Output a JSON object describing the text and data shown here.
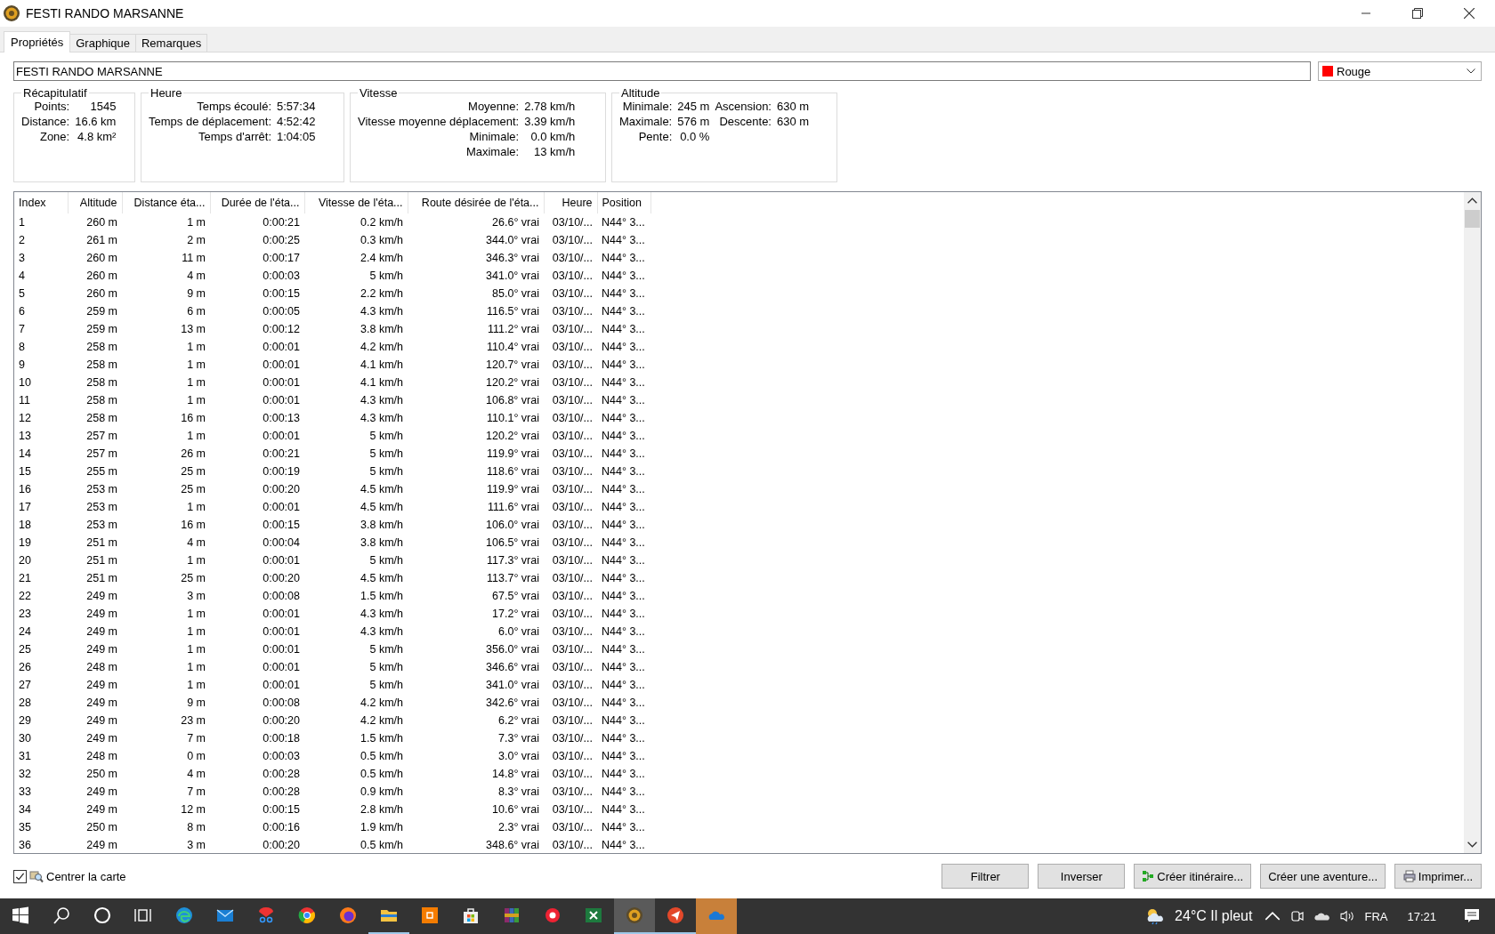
{
  "window": {
    "title": "FESTI RANDO MARSANNE"
  },
  "tabs": [
    {
      "label": "Propriétés",
      "selected": true
    },
    {
      "label": "Graphique",
      "selected": false
    },
    {
      "label": "Remarques",
      "selected": false
    }
  ],
  "name_field": {
    "value": "FESTI RANDO MARSANNE"
  },
  "color_select": {
    "value": "Rouge",
    "color": "#ff0000"
  },
  "groups": [
    {
      "title": "Récapitulatif",
      "rows": [
        [
          {
            "label": "Points:",
            "value": "1545"
          }
        ],
        [
          {
            "label": "Distance:",
            "value": "16.6 km"
          }
        ],
        [
          {
            "label": "Zone:",
            "value": "4.8 km²"
          }
        ]
      ]
    },
    {
      "title": "Heure",
      "rows": [
        [
          {
            "label": "Temps écoulé:",
            "value": "5:57:34"
          }
        ],
        [
          {
            "label": "Temps de déplacement:",
            "value": "4:52:42"
          }
        ],
        [
          {
            "label": "Temps d'arrêt:",
            "value": "1:04:05"
          }
        ]
      ]
    },
    {
      "title": "Vitesse",
      "rows": [
        [
          {
            "label": "Moyenne:",
            "value": "2.78 km/h"
          }
        ],
        [
          {
            "label": "Vitesse moyenne déplacement:",
            "value": "3.39 km/h"
          }
        ],
        [
          {
            "label": "Minimale:",
            "value": "0.0 km/h"
          }
        ],
        [
          {
            "label": "Maximale:",
            "value": "13 km/h"
          }
        ]
      ]
    },
    {
      "title": "Altitude",
      "rows": [
        [
          {
            "label": "Minimale:",
            "value": "245 m"
          },
          {
            "label": "Ascension:",
            "value": "630 m"
          }
        ],
        [
          {
            "label": "Maximale:",
            "value": "576 m"
          },
          {
            "label": "Descente:",
            "value": "630 m"
          }
        ],
        [
          {
            "label": "Pente:",
            "value": "0.0 %"
          }
        ]
      ]
    }
  ],
  "table": {
    "columns": [
      "Index",
      "Altitude",
      "Distance éta...",
      "Durée de l'éta...",
      "Vitesse de l'éta...",
      "Route désirée de l'éta...",
      "Heure",
      "Position"
    ],
    "rows": [
      [
        "1",
        "260 m",
        "1 m",
        "0:00:21",
        "0.2 km/h",
        "26.6° vrai",
        "03/10/...",
        "N44° 3..."
      ],
      [
        "2",
        "261 m",
        "2 m",
        "0:00:25",
        "0.3 km/h",
        "344.0° vrai",
        "03/10/...",
        "N44° 3..."
      ],
      [
        "3",
        "260 m",
        "11 m",
        "0:00:17",
        "2.4 km/h",
        "346.3° vrai",
        "03/10/...",
        "N44° 3..."
      ],
      [
        "4",
        "260 m",
        "4 m",
        "0:00:03",
        "5 km/h",
        "341.0° vrai",
        "03/10/...",
        "N44° 3..."
      ],
      [
        "5",
        "260 m",
        "9 m",
        "0:00:15",
        "2.2 km/h",
        "85.0° vrai",
        "03/10/...",
        "N44° 3..."
      ],
      [
        "6",
        "259 m",
        "6 m",
        "0:00:05",
        "4.3 km/h",
        "116.5° vrai",
        "03/10/...",
        "N44° 3..."
      ],
      [
        "7",
        "259 m",
        "13 m",
        "0:00:12",
        "3.8 km/h",
        "111.2° vrai",
        "03/10/...",
        "N44° 3..."
      ],
      [
        "8",
        "258 m",
        "1 m",
        "0:00:01",
        "4.2 km/h",
        "110.4° vrai",
        "03/10/...",
        "N44° 3..."
      ],
      [
        "9",
        "258 m",
        "1 m",
        "0:00:01",
        "4.1 km/h",
        "120.7° vrai",
        "03/10/...",
        "N44° 3..."
      ],
      [
        "10",
        "258 m",
        "1 m",
        "0:00:01",
        "4.1 km/h",
        "120.2° vrai",
        "03/10/...",
        "N44° 3..."
      ],
      [
        "11",
        "258 m",
        "1 m",
        "0:00:01",
        "4.3 km/h",
        "106.8° vrai",
        "03/10/...",
        "N44° 3..."
      ],
      [
        "12",
        "258 m",
        "16 m",
        "0:00:13",
        "4.3 km/h",
        "110.1° vrai",
        "03/10/...",
        "N44° 3..."
      ],
      [
        "13",
        "257 m",
        "1 m",
        "0:00:01",
        "5 km/h",
        "120.2° vrai",
        "03/10/...",
        "N44° 3..."
      ],
      [
        "14",
        "257 m",
        "26 m",
        "0:00:21",
        "5 km/h",
        "119.9° vrai",
        "03/10/...",
        "N44° 3..."
      ],
      [
        "15",
        "255 m",
        "25 m",
        "0:00:19",
        "5 km/h",
        "118.6° vrai",
        "03/10/...",
        "N44° 3..."
      ],
      [
        "16",
        "253 m",
        "25 m",
        "0:00:20",
        "4.5 km/h",
        "119.9° vrai",
        "03/10/...",
        "N44° 3..."
      ],
      [
        "17",
        "253 m",
        "1 m",
        "0:00:01",
        "4.5 km/h",
        "111.6° vrai",
        "03/10/...",
        "N44° 3..."
      ],
      [
        "18",
        "253 m",
        "16 m",
        "0:00:15",
        "3.8 km/h",
        "106.0° vrai",
        "03/10/...",
        "N44° 3..."
      ],
      [
        "19",
        "251 m",
        "4 m",
        "0:00:04",
        "3.8 km/h",
        "106.5° vrai",
        "03/10/...",
        "N44° 3..."
      ],
      [
        "20",
        "251 m",
        "1 m",
        "0:00:01",
        "5 km/h",
        "117.3° vrai",
        "03/10/...",
        "N44° 3..."
      ],
      [
        "21",
        "251 m",
        "25 m",
        "0:00:20",
        "4.5 km/h",
        "113.7° vrai",
        "03/10/...",
        "N44° 3..."
      ],
      [
        "22",
        "249 m",
        "3 m",
        "0:00:08",
        "1.5 km/h",
        "67.5° vrai",
        "03/10/...",
        "N44° 3..."
      ],
      [
        "23",
        "249 m",
        "1 m",
        "0:00:01",
        "4.3 km/h",
        "17.2° vrai",
        "03/10/...",
        "N44° 3..."
      ],
      [
        "24",
        "249 m",
        "1 m",
        "0:00:01",
        "4.3 km/h",
        "6.0° vrai",
        "03/10/...",
        "N44° 3..."
      ],
      [
        "25",
        "249 m",
        "1 m",
        "0:00:01",
        "5 km/h",
        "356.0° vrai",
        "03/10/...",
        "N44° 3..."
      ],
      [
        "26",
        "248 m",
        "1 m",
        "0:00:01",
        "5 km/h",
        "346.6° vrai",
        "03/10/...",
        "N44° 3..."
      ],
      [
        "27",
        "249 m",
        "1 m",
        "0:00:01",
        "5 km/h",
        "341.0° vrai",
        "03/10/...",
        "N44° 3..."
      ],
      [
        "28",
        "249 m",
        "9 m",
        "0:00:08",
        "4.2 km/h",
        "342.6° vrai",
        "03/10/...",
        "N44° 3..."
      ],
      [
        "29",
        "249 m",
        "23 m",
        "0:00:20",
        "4.2 km/h",
        "6.2° vrai",
        "03/10/...",
        "N44° 3..."
      ],
      [
        "30",
        "249 m",
        "7 m",
        "0:00:18",
        "1.5 km/h",
        "7.3° vrai",
        "03/10/...",
        "N44° 3..."
      ],
      [
        "31",
        "248 m",
        "0 m",
        "0:00:03",
        "0.5 km/h",
        "3.0° vrai",
        "03/10/...",
        "N44° 3..."
      ],
      [
        "32",
        "250 m",
        "4 m",
        "0:00:28",
        "0.5 km/h",
        "14.8° vrai",
        "03/10/...",
        "N44° 3..."
      ],
      [
        "33",
        "249 m",
        "7 m",
        "0:00:28",
        "0.9 km/h",
        "8.3° vrai",
        "03/10/...",
        "N44° 3..."
      ],
      [
        "34",
        "249 m",
        "12 m",
        "0:00:15",
        "2.8 km/h",
        "10.6° vrai",
        "03/10/...",
        "N44° 3..."
      ],
      [
        "35",
        "250 m",
        "8 m",
        "0:00:16",
        "1.9 km/h",
        "2.3° vrai",
        "03/10/...",
        "N44° 3..."
      ],
      [
        "36",
        "249 m",
        "3 m",
        "0:00:20",
        "0.5 km/h",
        "348.6° vrai",
        "03/10/...",
        "N44° 3..."
      ]
    ]
  },
  "center_map": {
    "label": "Centrer la carte",
    "checked": true
  },
  "buttons": [
    {
      "label": "Filtrer",
      "kind": "plain"
    },
    {
      "label": "Inverser",
      "kind": "plain"
    },
    {
      "label": "Créer itinéraire...",
      "kind": "route"
    },
    {
      "label": "Créer une aventure...",
      "kind": "plain"
    },
    {
      "label": "Imprimer...",
      "kind": "print"
    }
  ],
  "taskbar": {
    "apps": [
      {
        "running": false,
        "selected": false,
        "flashing": false
      },
      {
        "running": false,
        "selected": false,
        "flashing": false
      },
      {
        "running": false,
        "selected": false,
        "flashing": false
      },
      {
        "running": false,
        "selected": false,
        "flashing": false
      },
      {
        "running": false,
        "selected": false,
        "flashing": false
      },
      {
        "running": false,
        "selected": false,
        "flashing": false
      },
      {
        "running": false,
        "selected": false,
        "flashing": false
      },
      {
        "running": false,
        "selected": false,
        "flashing": false
      },
      {
        "running": false,
        "selected": false,
        "flashing": false
      },
      {
        "running": true,
        "selected": false,
        "flashing": false
      },
      {
        "running": false,
        "selected": false,
        "flashing": false
      },
      {
        "running": false,
        "selected": false,
        "flashing": false
      },
      {
        "running": false,
        "selected": false,
        "flashing": false
      },
      {
        "running": false,
        "selected": false,
        "flashing": false
      },
      {
        "running": false,
        "selected": false,
        "flashing": false
      },
      {
        "running": true,
        "selected": true,
        "flashing": false
      },
      {
        "running": true,
        "selected": false,
        "flashing": false
      },
      {
        "running": false,
        "selected": false,
        "flashing": true
      }
    ],
    "weather": "24°C  Il pleut",
    "language": "FRA",
    "time": "17:21"
  }
}
